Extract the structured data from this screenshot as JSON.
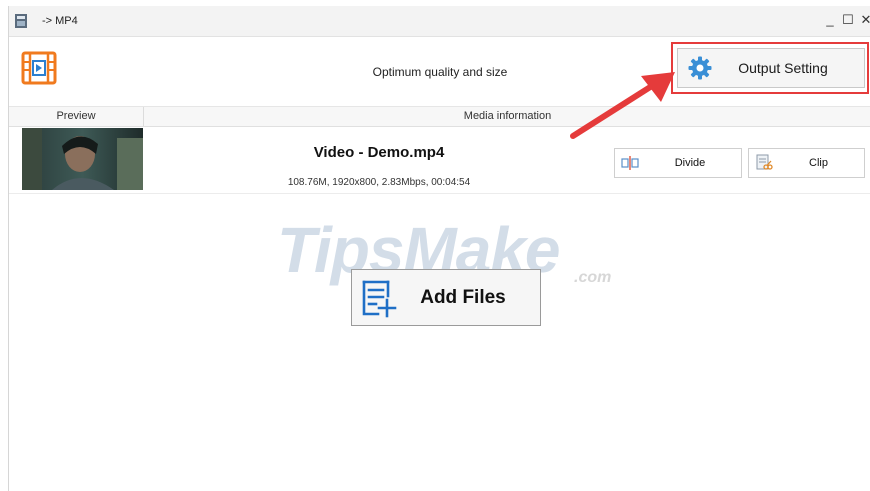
{
  "window": {
    "title": "-> MP4",
    "controls": {
      "minimize": "_",
      "maximize": "☐",
      "close": "✕"
    }
  },
  "toolbar": {
    "profile_description": "Optimum quality and size",
    "output_setting_label": "Output Setting"
  },
  "columns": {
    "preview": "Preview",
    "media_information": "Media information"
  },
  "file": {
    "name": "Video - Demo.mp4",
    "meta": "108.76M, 1920x800, 2.83Mbps, 00:04:54",
    "divide_label": "Divide",
    "clip_label": "Clip"
  },
  "add_files_label": "Add Files",
  "watermark": {
    "main": "TipsMake",
    "sub": ".com"
  },
  "colors": {
    "highlight": "#e53b3b",
    "accent_orange": "#f07a1e",
    "gear_blue": "#3a8fd6",
    "add_icon_blue": "#1f6fc6"
  },
  "icons": {
    "app": "app-icon",
    "format": "video-format-icon",
    "output_setting": "gear-icon",
    "divide": "divide-icon",
    "clip": "clip-icon",
    "add_files": "add-files-icon"
  }
}
